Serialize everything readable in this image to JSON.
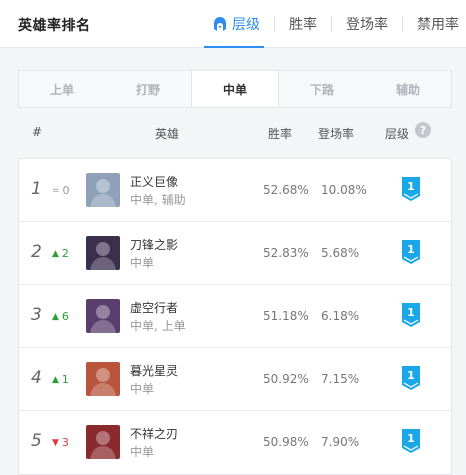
{
  "header": {
    "title": "英雄率排名",
    "nav": [
      {
        "label": "层级",
        "active": true
      },
      {
        "label": "胜率",
        "active": false
      },
      {
        "label": "登场率",
        "active": false
      },
      {
        "label": "禁用率",
        "active": false
      }
    ]
  },
  "tabs": [
    {
      "label": "上单",
      "active": false
    },
    {
      "label": "打野",
      "active": false
    },
    {
      "label": "中单",
      "active": true
    },
    {
      "label": "下路",
      "active": false
    },
    {
      "label": "辅助",
      "active": false
    }
  ],
  "columns": {
    "rank": "#",
    "hero": "英雄",
    "win_rate": "胜率",
    "pick_rate": "登场率",
    "tier": "层级",
    "help": "?"
  },
  "rows": [
    {
      "rank": "1",
      "trend": "same",
      "trend_text": "0",
      "name": "正义巨像",
      "positions": "中单, 辅助",
      "win_rate": "52.68%",
      "pick_rate": "10.08%",
      "tier": "1",
      "avatar_color": "#8ea1b8"
    },
    {
      "rank": "2",
      "trend": "up",
      "trend_text": "2",
      "name": "刀锋之影",
      "positions": "中单",
      "win_rate": "52.83%",
      "pick_rate": "5.68%",
      "tier": "1",
      "avatar_color": "#3a2f4d"
    },
    {
      "rank": "3",
      "trend": "up",
      "trend_text": "6",
      "name": "虚空行者",
      "positions": "中单, 上单",
      "win_rate": "51.18%",
      "pick_rate": "6.18%",
      "tier": "1",
      "avatar_color": "#5a3f6e"
    },
    {
      "rank": "4",
      "trend": "up",
      "trend_text": "1",
      "name": "暮光星灵",
      "positions": "中单",
      "win_rate": "50.92%",
      "pick_rate": "7.15%",
      "tier": "1",
      "avatar_color": "#b8553c"
    },
    {
      "rank": "5",
      "trend": "down",
      "trend_text": "3",
      "name": "不祥之刃",
      "positions": "中单",
      "win_rate": "50.98%",
      "pick_rate": "7.90%",
      "tier": "1",
      "avatar_color": "#8a2a2e"
    }
  ],
  "colors": {
    "accent": "#2f8cf0",
    "up": "#2aa035",
    "down": "#e03a3a",
    "tier_badge": "#1aa7e8"
  },
  "icons": {
    "nav_tier": "helmet-icon",
    "trend_up": "triangle-up-icon",
    "trend_down": "triangle-down-icon",
    "trend_same": "equals-icon",
    "tier_badge": "tier-badge-icon"
  }
}
